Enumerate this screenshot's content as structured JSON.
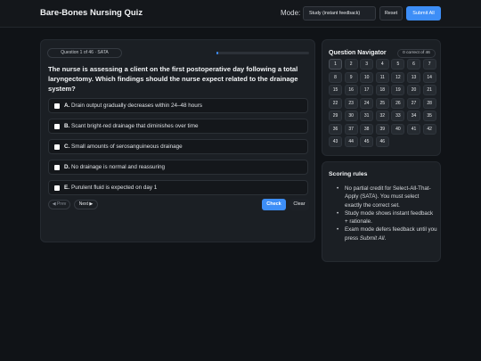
{
  "header": {
    "title": "Bare-Bones Nursing Quiz",
    "mode_label": "Mode:",
    "mode_value": "Study (instant feedback)",
    "reset_label": "Reset",
    "submit_label": "Submit All"
  },
  "question": {
    "meta": "Question 1 of 46 · SATA",
    "progress_fraction": 0.02,
    "stem": "The nurse is assessing a client on the first postoperative day following a total laryngectomy. Which findings should the nurse expect related to the drainage system?",
    "options": [
      {
        "letter": "A.",
        "text": "Drain output gradually decreases within 24–48 hours"
      },
      {
        "letter": "B.",
        "text": "Scant bright-red drainage that diminishes over time"
      },
      {
        "letter": "C.",
        "text": "Small amounts of serosanguineous drainage"
      },
      {
        "letter": "D.",
        "text": "No drainage is normal and reassuring"
      },
      {
        "letter": "E.",
        "text": "Purulent fluid is expected on day 1"
      }
    ],
    "prev_label": "◀ Prev",
    "next_label": "Next ▶",
    "check_label": "Check",
    "clear_label": "Clear"
  },
  "navigator": {
    "title": "Question Navigator",
    "count": "0 correct of 46",
    "numbers": [
      "1",
      "2",
      "3",
      "4",
      "5",
      "6",
      "7",
      "8",
      "9",
      "10",
      "11",
      "12",
      "13",
      "14",
      "15",
      "16",
      "17",
      "18",
      "19",
      "20",
      "21",
      "22",
      "23",
      "24",
      "25",
      "26",
      "27",
      "28",
      "29",
      "30",
      "31",
      "32",
      "33",
      "34",
      "35",
      "36",
      "37",
      "38",
      "39",
      "40",
      "41",
      "42",
      "43",
      "44",
      "45",
      "46"
    ]
  },
  "rules": {
    "title": "Scoring rules",
    "items": [
      "No partial credit for Select-All-That-Apply (SATA). You must select exactly the correct set.",
      "Study mode shows instant feedback + rationale."
    ],
    "exam_prefix": "Exam mode defers feedback until you press ",
    "exam_emph": "Submit All",
    "exam_suffix": "."
  },
  "colors": {
    "accent": "#3d8ef7",
    "background": "#101317",
    "card": "#1b1f24"
  }
}
